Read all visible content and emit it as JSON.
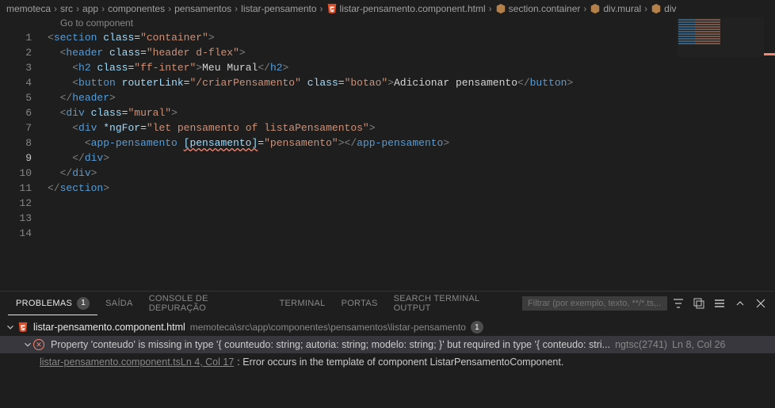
{
  "breadcrumb": {
    "items": [
      "memoteca",
      "src",
      "app",
      "componentes",
      "pensamentos",
      "listar-pensamento",
      "listar-pensamento.component.html",
      "section.container",
      "div.mural",
      "div"
    ]
  },
  "goToComponent": "Go to component",
  "lines": {
    "count": 14,
    "active": 9
  },
  "code": {
    "l1": {
      "t1": "section",
      "a1": "class",
      "v1": "\"container\""
    },
    "l2": {
      "t1": "header",
      "a1": "class",
      "v1": "\"header d-flex\""
    },
    "l3": {
      "t1": "h2",
      "a1": "class",
      "v1": "\"ff-inter\"",
      "txt": "Meu Mural",
      "t2": "h2"
    },
    "l4": {
      "t1": "button",
      "a1": "routerLink",
      "v1": "\"/criarPensamento\"",
      "a2": "class",
      "v2": "\"botao\"",
      "txt": "Adicionar pensamento",
      "t2": "button"
    },
    "l5": {
      "t1": "header"
    },
    "l6": {
      "t1": "div",
      "a1": "class",
      "v1": "\"mural\""
    },
    "l7": {
      "t1": "div",
      "a1": "*ngFor",
      "v1": "\"let pensamento of listaPensamentos\""
    },
    "l8": {
      "t1": "app-pensamento",
      "a1": "[pensamento]",
      "v1": "\"pensamento\"",
      "t2": "app-pensamento"
    },
    "l9": {
      "t1": "div"
    },
    "l10": {
      "t1": "div"
    },
    "l11": {
      "t1": "section"
    }
  },
  "panel": {
    "tabs": {
      "problemas": "PROBLEMAS",
      "problemasBadge": "1",
      "saida": "SAÍDA",
      "console": "CONSOLE DE DEPURAÇÃO",
      "terminal": "TERMINAL",
      "portas": "PORTAS",
      "search": "SEARCH TERMINAL OUTPUT"
    },
    "filterPlaceholder": "Filtrar (por exemplo, texto, **/*.ts,...",
    "file": {
      "name": "listar-pensamento.component.html",
      "path": "memoteca\\src\\app\\componentes\\pensamentos\\listar-pensamento",
      "badge": "1"
    },
    "error": {
      "msg": "Property 'conteudo' is missing in type '{ counteudo: string; autoria: string; modelo: string; }' but required in type '{ conteudo: stri...",
      "code": "ngtsc(2741)",
      "loc": "Ln 8, Col 26"
    },
    "sub": {
      "link": "listar-pensamento.component.tsLn 4, Col 17",
      "text": ": Error occurs in the template of component ListarPensamentoComponent."
    }
  }
}
